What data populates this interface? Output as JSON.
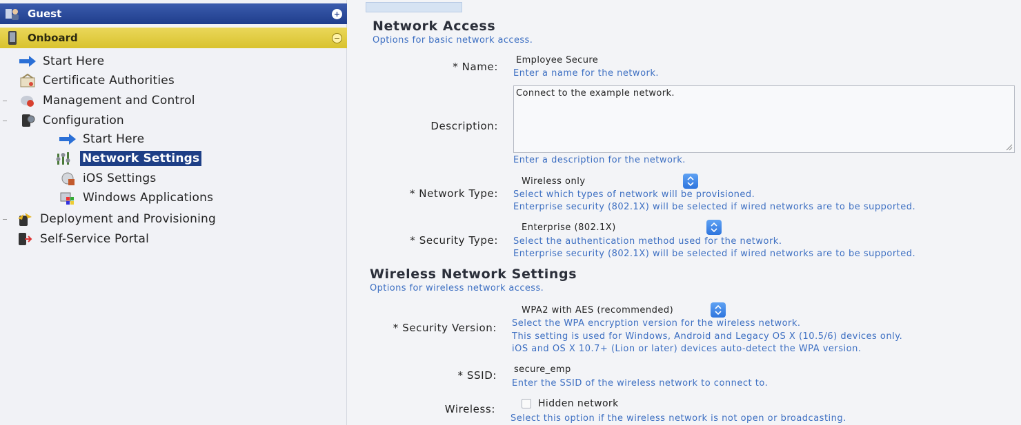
{
  "sidebar": {
    "guest_label": "Guest",
    "onboard_label": "Onboard",
    "items": [
      {
        "label": "Start Here"
      },
      {
        "label": "Certificate Authorities"
      },
      {
        "label": "Management and Control"
      },
      {
        "label": "Configuration"
      },
      {
        "label": "Start Here"
      },
      {
        "label": "Network Settings"
      },
      {
        "label": "iOS Settings"
      },
      {
        "label": "Windows Applications"
      },
      {
        "label": "Deployment and Provisioning"
      },
      {
        "label": "Self-Service Portal"
      }
    ]
  },
  "network_access": {
    "title": "Network Access",
    "subtitle": "Options for basic network access.",
    "name": {
      "label": "* Name:",
      "value": "Employee Secure",
      "hint": "Enter a name for the network."
    },
    "description": {
      "label": "Description:",
      "value": "Connect to the example network.",
      "hint": "Enter a description for the network."
    },
    "network_type": {
      "label": "* Network Type:",
      "value": "Wireless only",
      "hint1": "Select which types of network will be provisioned.",
      "hint2": "Enterprise security (802.1X) will be selected if wired networks are to be supported."
    },
    "security_type": {
      "label": "* Security Type:",
      "value": "Enterprise (802.1X)",
      "hint1": "Select the authentication method used for the network.",
      "hint2": "Enterprise security (802.1X) will be selected if wired networks are to be supported."
    }
  },
  "wireless": {
    "title": "Wireless Network Settings",
    "subtitle": "Options for wireless network access.",
    "security_version": {
      "label": "* Security Version:",
      "value": "WPA2 with AES (recommended)",
      "hint1": "Select the WPA encryption version for the wireless network.",
      "hint2": "This setting is used for Windows, Android and Legacy OS X (10.5/6) devices only.",
      "hint3": "iOS and OS X 10.7+ (Lion or later) devices auto-detect the WPA version."
    },
    "ssid": {
      "label": "* SSID:",
      "value": "secure_emp",
      "hint": "Enter the SSID of the wireless network to connect to."
    },
    "wireless_hidden": {
      "label": "Wireless:",
      "checkbox_label": "Hidden network",
      "checked": false,
      "hint": "Select this option if the wireless network is not open or broadcasting."
    }
  },
  "colors": {
    "accent_blue": "#1e3f86",
    "hint_blue": "#3d6fc2",
    "onboard_yellow": "#ead75a"
  }
}
